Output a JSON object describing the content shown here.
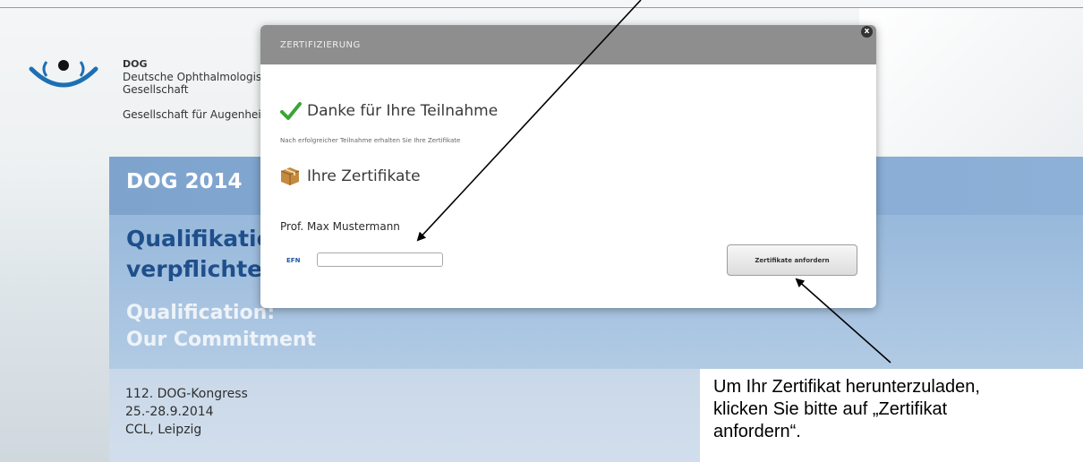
{
  "site": {
    "org_abbr": "DOG",
    "org_name_line1": "Deutsche Ophthalmologisc",
    "org_name_line2": "Gesellschaft",
    "org_tagline": "Gesellschaft für Augenheill"
  },
  "banner": {
    "year_title": "DOG 2014",
    "tagline_de_line1": "Qualifikatio",
    "tagline_de_line2": "verpflichtet!",
    "tagline_en_line1": "Qualification:",
    "tagline_en_line2": "Our Commitment",
    "congress_line1": "112. DOG-Kongress",
    "congress_line2": "25.-28.9.2014",
    "congress_line3": "CCL, Leipzig"
  },
  "dialog": {
    "title": "ZERTIFIZIERUNG",
    "close_symbol": "x",
    "thanks": "Danke für Ihre Teilnahme",
    "note": "Nach erfolgreicher Teilnahme erhalten Sie Ihre Zertifikate",
    "certs_heading": "Ihre Zertifikate",
    "participant_name": "Prof. Max Mustermann",
    "efn_label": "EFN",
    "efn_value": "",
    "request_button": "Zertifikate anfordern"
  },
  "callout": {
    "text_line1": "Um Ihr Zertifikat herunterzuladen,",
    "text_line2": "klicken Sie bitte auf „Zertifikat",
    "text_line3": "anfordern“."
  },
  "colors": {
    "banner_blue": "#8fb2d8",
    "tagline_dark_blue": "#1f4f8b",
    "dialog_header": "#8e8e8e",
    "check_green": "#3aa535"
  }
}
